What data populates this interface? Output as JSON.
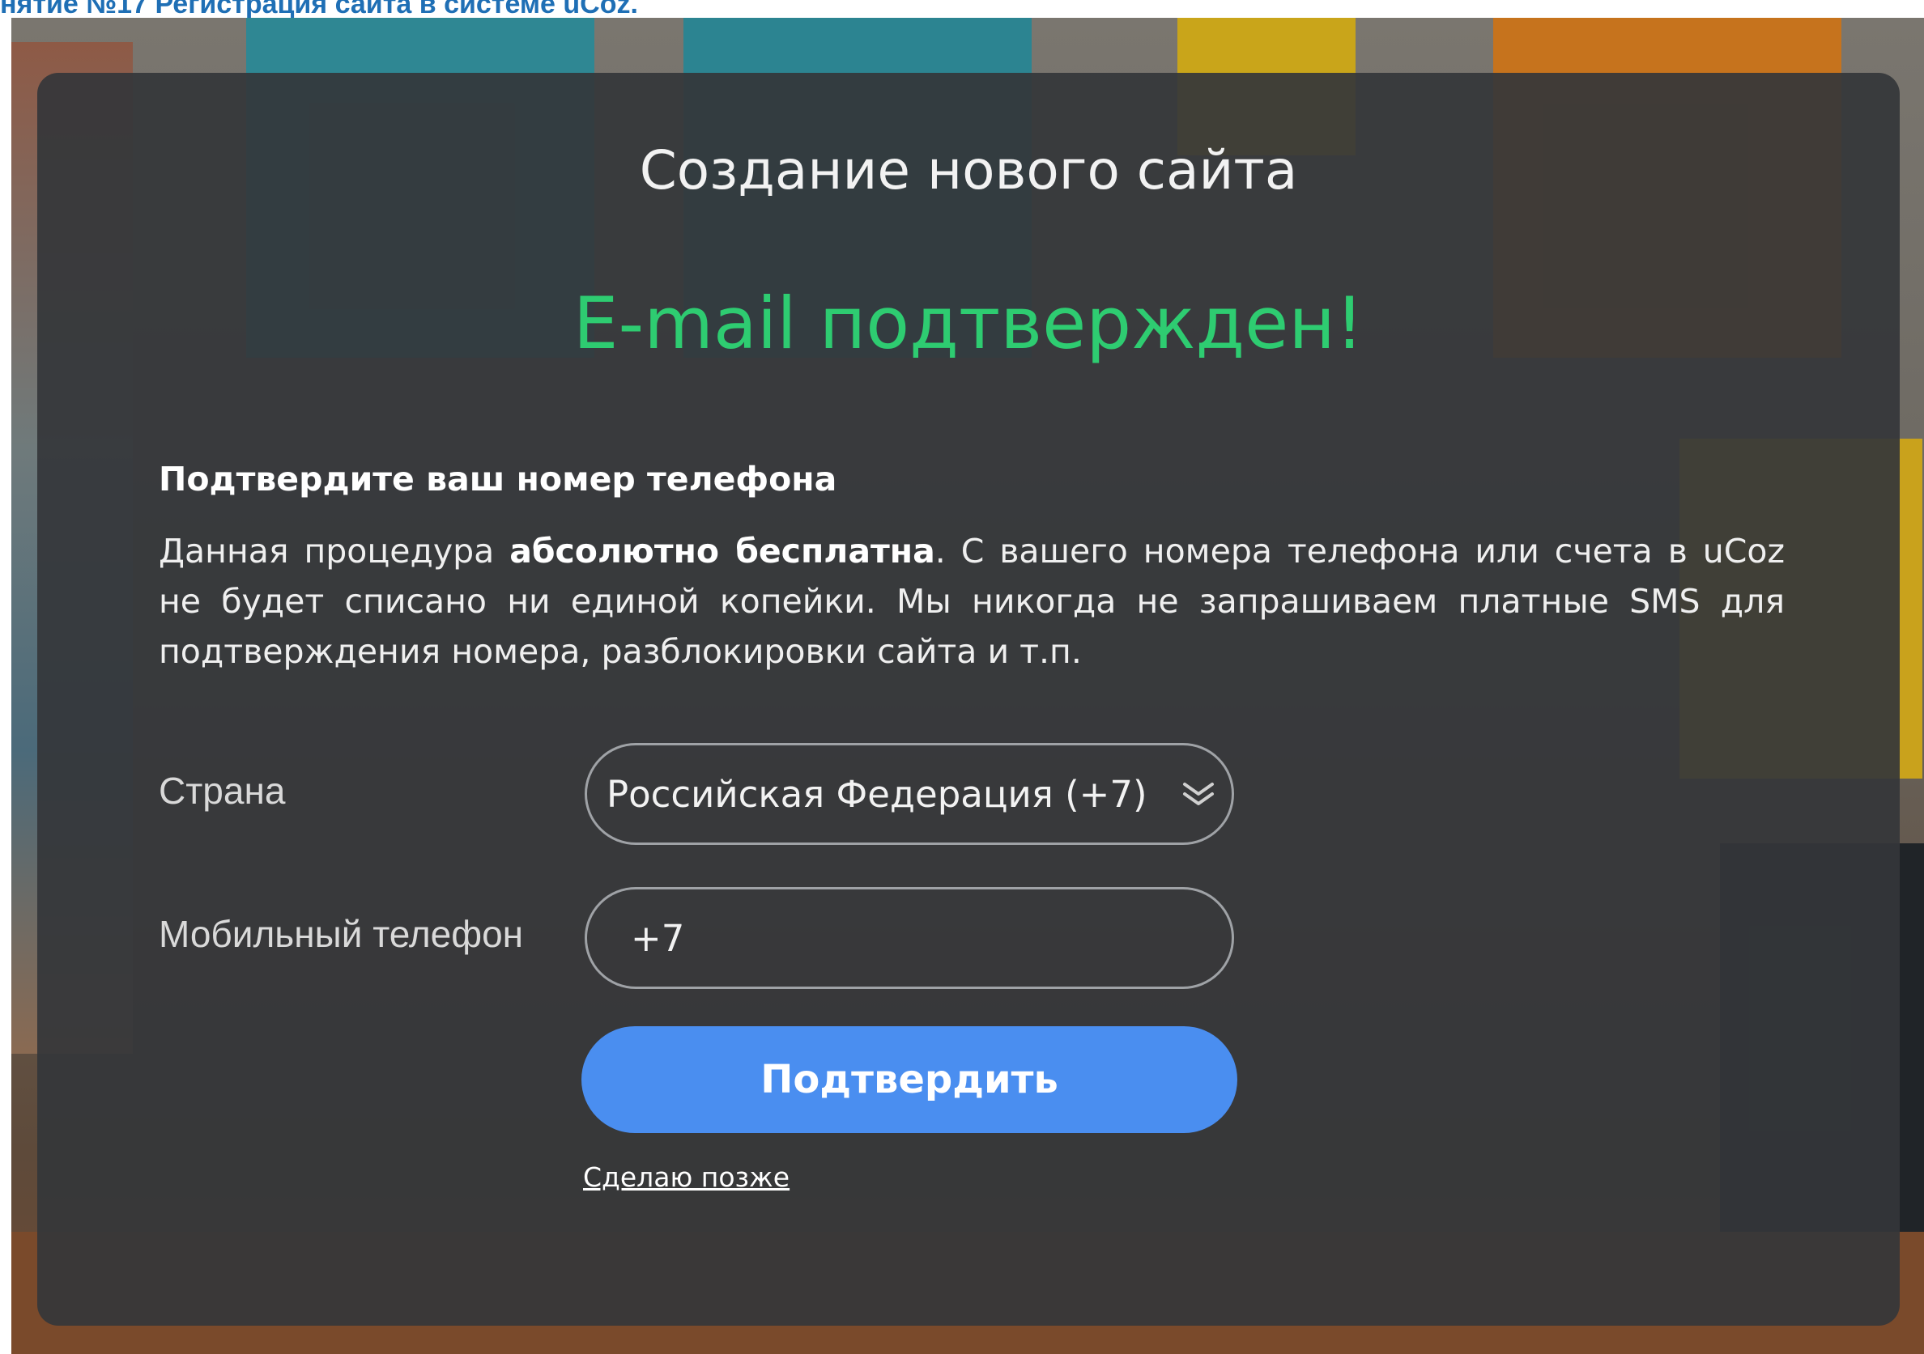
{
  "caption": {
    "text": "нятие №17 Регистрация сайта в системе uCoz."
  },
  "dialog": {
    "title": "Создание нового сайта",
    "status_message": "E-mail подтвержден!",
    "section_title": "Подтвердите ваш номер телефона",
    "description": {
      "part1": "Данная процедура ",
      "bold": "абсолютно бесплатна",
      "part2": ". С вашего номера телефона или счета в uCoz не будет списано ни единой копейки. Мы никогда не запрашиваем платные SMS для подтверждения номера, разблокировки сайта и т.п."
    },
    "country_label": "Страна",
    "country_selected": "Российская Федерация (+7)",
    "phone_label": "Мобильный телефон",
    "phone_value": "+7",
    "confirm_button": "Подтвердить",
    "later_link": "Сделаю позже"
  },
  "icons": {
    "select_chevron": "double-chevron-down-icon"
  },
  "colors": {
    "success_green": "#2ecc71",
    "button_blue": "#4a8ef0",
    "overlay": "#343639",
    "caption_blue": "#1f6fb5"
  }
}
